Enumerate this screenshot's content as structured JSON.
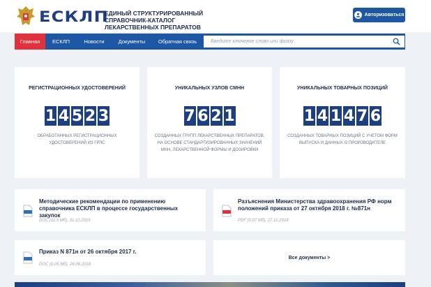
{
  "header": {
    "logo": "ЕСКЛП",
    "subtitle": "ЕДИНЫЙ СТРУКТУРИРОВАННЫЙ СПРАВОЧНИК-КАТАЛОГ ЛЕКАРСТВЕННЫХ ПРЕПАРАТОВ",
    "auth_label": "Авторизоваться",
    "emblem_icon": "coat-of-arms-icon",
    "user_icon": "user-icon"
  },
  "nav": {
    "items": [
      {
        "label": "Главная",
        "active": true
      },
      {
        "label": "ЕСКЛП",
        "active": false
      },
      {
        "label": "Новости",
        "active": false
      },
      {
        "label": "Документы",
        "active": false
      },
      {
        "label": "Обратная связь",
        "active": false
      }
    ]
  },
  "search": {
    "placeholder": "Введите ключевое слово или фразу",
    "icon": "search-icon"
  },
  "stats": [
    {
      "title": "РЕГИСТРАЦИОННЫХ УДОСТОВЕРЕНИЙ",
      "digits": [
        "1",
        "4",
        "5",
        "2",
        "3"
      ],
      "description": "ОБРАБОТАННЫХ РЕГИСТРАЦИОННЫХ УДОСТОВЕРЕНИЙ ИЗ ГРЛС"
    },
    {
      "title": "УНИКАЛЬНЫХ УЗЛОВ СМНН",
      "digits": [
        "7",
        "6",
        "2",
        "1"
      ],
      "description": "СОЗДАННЫХ ГРУПП ЛЕКАРСТВЕННЫХ ПРЕПАРАТОВ, НА ОСНОВЕ СТАНДАРТИЗИРОВАННЫХ ЗНАЧЕНИЙ МНН, ЛЕКАРСТВЕННОЙ ФОРМЫ И ДОЗИРОВКИ"
    },
    {
      "title": "УНИКАЛЬНЫХ ТОВАРНЫХ ПОЗИЦИЙ",
      "digits": [
        "1",
        "4",
        "1",
        "4",
        "7",
        "6"
      ],
      "description": "СОЗДАННЫХ ТОВАРНЫХ ПОЗИЦИЙ С УЧЕТОМ ФОРМ ВЫПУСКА И ДАННЫХ О ПРОИЗВОДИТЕЛЕ"
    }
  ],
  "documents": [
    {
      "title": "Методические рекомендации по применению справочника ЕСКЛП в процессе государственных закупок",
      "meta": "DOC (11.5 Мб), 31.10.2019",
      "icon": "doc-file-icon",
      "icon_color": "#2f6fb3"
    },
    {
      "title": "Разъяснения Министерства здравоохранения РФ норм положений приказа от 27 октября 2018 г. №871н",
      "meta": "PDF (0.07 Мб), 27.12.2018",
      "icon": "pdf-file-icon",
      "icon_color": "#e0313c"
    },
    {
      "title": "Приказ N 871н от 26 октября 2017 г.",
      "meta": "DOC (0.05 Мб), 26.06.2018",
      "icon": "doc-file-icon",
      "icon_color": "#2f6fb3"
    }
  ],
  "all_docs_label": "Все документы >",
  "colors": {
    "primary": "#1d56a3",
    "active": "#e0313c",
    "digit_bg": "#1d3e80",
    "page_bg": "#eef2f7"
  }
}
